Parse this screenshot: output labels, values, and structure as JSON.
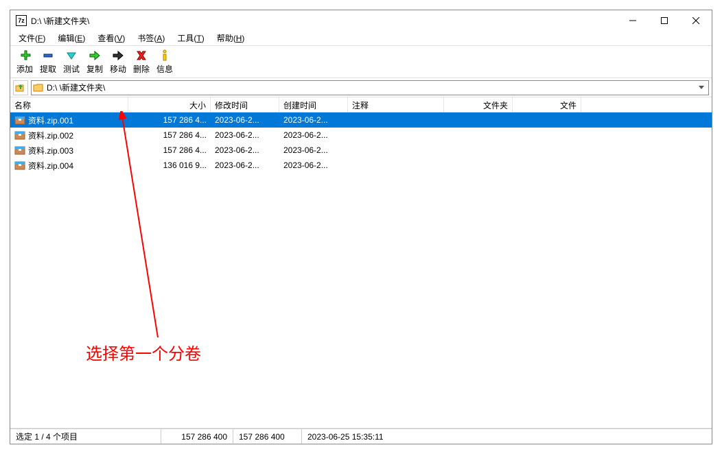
{
  "title": "D:\\        \\新建文件夹\\",
  "menu": {
    "file": "文件(F)",
    "edit": "编辑(E)",
    "view": "查看(V)",
    "bookmarks": "书签(A)",
    "tools": "工具(T)",
    "help": "帮助(H)"
  },
  "toolbar": {
    "add": "添加",
    "extract": "提取",
    "test": "测试",
    "copy": "复制",
    "move": "移动",
    "delete": "删除",
    "info": "信息"
  },
  "path": "D:\\        \\新建文件夹\\",
  "columns": {
    "name": "名称",
    "size": "大小",
    "modified": "修改时间",
    "created": "创建时间",
    "comment": "注释",
    "folders": "文件夹",
    "files": "文件"
  },
  "files": [
    {
      "name": "资料.zip.001",
      "size": "157 286 4...",
      "modified": "2023-06-2...",
      "created": "2023-06-2...",
      "selected": true
    },
    {
      "name": "资料.zip.002",
      "size": "157 286 4...",
      "modified": "2023-06-2...",
      "created": "2023-06-2...",
      "selected": false
    },
    {
      "name": "资料.zip.003",
      "size": "157 286 4...",
      "modified": "2023-06-2...",
      "created": "2023-06-2...",
      "selected": false
    },
    {
      "name": "资料.zip.004",
      "size": "136 016 9...",
      "modified": "2023-06-2...",
      "created": "2023-06-2...",
      "selected": false
    }
  ],
  "annotation": "选择第一个分卷",
  "statusbar": {
    "selection": "选定 1 / 4 个项目",
    "size1": "157 286 400",
    "size2": "157 286 400",
    "datetime": "2023-06-25 15:35:11"
  }
}
